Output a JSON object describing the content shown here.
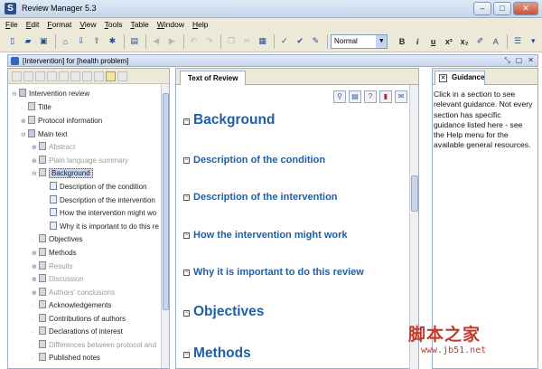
{
  "window": {
    "title": "Review Manager 5.3",
    "app_icon_letter": "S"
  },
  "menu": [
    "File",
    "Edit",
    "Format",
    "View",
    "Tools",
    "Table",
    "Window",
    "Help"
  ],
  "toolbar": {
    "style_value": "Normal",
    "bold": "B",
    "italic": "i",
    "underline": "u",
    "superscript": "x²",
    "subscript": "x₂"
  },
  "review": {
    "title": "[Intervention] for [health problem]"
  },
  "tree": {
    "items": [
      {
        "label": "Intervention review"
      },
      {
        "label": "Title"
      },
      {
        "label": "Protocol information"
      },
      {
        "label": "Main text"
      },
      {
        "label": "Abstract"
      },
      {
        "label": "Plain language summary"
      },
      {
        "label": "Background"
      },
      {
        "label": "Description of the condition"
      },
      {
        "label": "Description of the intervention"
      },
      {
        "label": "How the intervention might wo"
      },
      {
        "label": "Why it is important to do this re"
      },
      {
        "label": "Objectives"
      },
      {
        "label": "Methods"
      },
      {
        "label": "Results"
      },
      {
        "label": "Discussion"
      },
      {
        "label": "Authors' conclusions"
      },
      {
        "label": "Acknowledgements"
      },
      {
        "label": "Contributions of authors"
      },
      {
        "label": "Declarations of interest"
      },
      {
        "label": "Differences between protocol and"
      },
      {
        "label": "Published notes"
      }
    ]
  },
  "text_of_review": {
    "tab_label": "Text of Review",
    "headings": [
      {
        "text": "Background"
      },
      {
        "text": "Description of the condition"
      },
      {
        "text": "Description of the intervention"
      },
      {
        "text": "How the intervention might work"
      },
      {
        "text": "Why it is important to do this review"
      },
      {
        "text": "Objectives"
      },
      {
        "text": "Methods"
      }
    ]
  },
  "guidance": {
    "tab_label": "Guidance",
    "text": "Click in a section to see relevant guidance. Not every section has specific guidance listed here - see the Help menu for the available general resources."
  },
  "watermark": {
    "big": "脚本之家",
    "small": "www.jb51.net"
  }
}
